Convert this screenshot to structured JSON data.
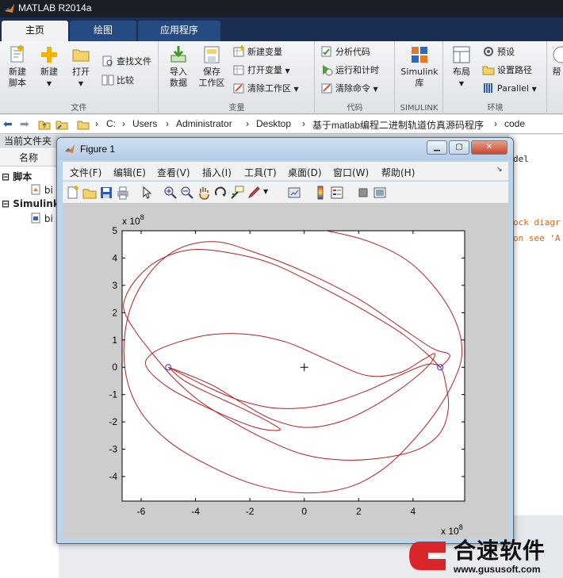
{
  "app": {
    "title": "MATLAB R2014a"
  },
  "tabs": [
    {
      "label": "主页",
      "active": true
    },
    {
      "label": "绘图",
      "active": false
    },
    {
      "label": "应用程序",
      "active": false
    }
  ],
  "ribbon": {
    "file": {
      "name": "文件",
      "new_script": "新建\n脚本",
      "new": "新建",
      "open": "打开",
      "find_files": "查找文件",
      "compare": "比较"
    },
    "variable": {
      "name": "变量",
      "import": "导入\n数据",
      "save_ws": "保存\n工作区",
      "new_var": "新建变量",
      "open_var": "打开变量",
      "clear_ws": "清除工作区"
    },
    "code": {
      "name": "代码",
      "analyze": "分析代码",
      "run_time": "运行和计时",
      "clear_cmd": "清除命令"
    },
    "simulink": {
      "name": "SIMULINK",
      "lib": "Simulink\n库"
    },
    "env": {
      "name": "环境",
      "layout": "布局",
      "prefs": "预设",
      "set_path": "设置路径",
      "parallel": "Parallel",
      "help": "帮"
    }
  },
  "address": {
    "crumbs": [
      "C:",
      "Users",
      "Administrator",
      "Desktop",
      "基于matlab编程二进制轨道仿真源码程序",
      "code"
    ]
  },
  "left": {
    "header": "当前文件夹",
    "col_name": "名称",
    "group1": "脚本",
    "item1": "bi",
    "group2": "Simulink",
    "item2": "bi"
  },
  "right": {
    "lines": [
      "del",
      "ock diagr",
      "on see ‘A"
    ]
  },
  "figure": {
    "title": "Figure 1",
    "menu": [
      "文件(F)",
      "编辑(E)",
      "查看(V)",
      "插入(I)",
      "工具(T)",
      "桌面(D)",
      "窗口(W)",
      "帮助(H)"
    ]
  },
  "chart_data": {
    "type": "line",
    "title": "",
    "xlabel": "",
    "ylabel": "",
    "x_exponent_label": "x 10",
    "y_exponent_label": "x 10",
    "exponent": "8",
    "xlim": [
      -6.7,
      5.9
    ],
    "ylim": [
      -4.9,
      5.0
    ],
    "xticks": [
      -6,
      -4,
      -2,
      0,
      2,
      4
    ],
    "yticks": [
      -4,
      -3,
      -2,
      -1,
      0,
      1,
      2,
      3,
      4,
      5
    ],
    "grid": false,
    "line_color": "#b22222",
    "marker_color": "#3333cc",
    "series": [
      {
        "x": [
          -5.0,
          -4.4,
          -3.4,
          -2.3,
          -1.3,
          -0.9,
          -1.8,
          -3.3,
          -4.9,
          -5.8,
          -5.6,
          -4.7,
          -3.4,
          -2.0,
          -0.6,
          0.8,
          2.3,
          3.5,
          4.4,
          4.8,
          4.6,
          3.8,
          2.6,
          1.3,
          0.0,
          -1.2,
          -2.3,
          -3.3,
          -4.2,
          -5.0
        ],
        "y": [
          0.0,
          -0.5,
          -1.0,
          -1.5,
          -2.0,
          -2.3,
          -2.2,
          -1.6,
          -0.8,
          0.0,
          0.5,
          0.9,
          1.2,
          1.2,
          0.9,
          0.3,
          -0.3,
          -0.2,
          0.3,
          0.5,
          0.1,
          -0.6,
          -1.4,
          -2.0,
          -2.2,
          -1.9,
          -1.3,
          -0.7,
          -0.3,
          0.0
        ]
      },
      {
        "x": [
          -5.0,
          -4.6,
          -3.6,
          -2.4,
          -1.0,
          0.6,
          2.2,
          3.5,
          4.5,
          5.0,
          5.2,
          5.3,
          5.0,
          4.2,
          3.0,
          1.5,
          0.0,
          -1.5,
          -2.8,
          -3.9,
          -4.8,
          -5.5,
          -6.2,
          -6.6,
          -6.6,
          -6.2,
          -5.4,
          -4.2,
          -2.8,
          -1.2,
          0.5,
          2.0,
          3.5,
          4.5,
          5.0
        ],
        "y": [
          0.0,
          -0.2,
          -0.7,
          -1.2,
          -1.5,
          -1.4,
          -0.9,
          -0.3,
          0.1,
          0.0,
          -0.6,
          -1.5,
          -2.4,
          -3.0,
          -3.3,
          -3.4,
          -3.2,
          -2.6,
          -1.9,
          -1.2,
          -0.4,
          0.4,
          1.3,
          2.0,
          2.5,
          3.2,
          3.9,
          4.3,
          4.2,
          3.8,
          3.0,
          2.2,
          1.3,
          0.5,
          0.0
        ]
      },
      {
        "x": [
          5.0,
          5.3,
          5.3,
          4.7,
          3.5,
          2.0,
          0.0,
          -1.8,
          -3.3,
          -4.7,
          -5.8,
          -6.5,
          -6.6,
          -6.1,
          -5.0,
          -3.5,
          -1.8,
          0.0,
          1.6,
          2.8,
          3.8,
          4.8,
          5.5,
          5.8,
          5.6,
          4.9,
          3.8,
          2.4,
          0.8,
          -0.3
        ],
        "y": [
          0.0,
          0.3,
          0.5,
          0.7,
          1.5,
          2.5,
          3.5,
          4.2,
          4.6,
          4.3,
          3.3,
          1.8,
          0.0,
          -1.5,
          -2.7,
          -3.6,
          -4.3,
          -4.6,
          -4.4,
          -3.8,
          -2.9,
          -1.7,
          -0.5,
          0.5,
          1.6,
          2.8,
          3.9,
          4.6,
          5.0,
          5.1
        ]
      }
    ],
    "markers": [
      {
        "x": -5.0,
        "y": 0.0,
        "shape": "circle"
      },
      {
        "x": 5.0,
        "y": 0.0,
        "shape": "circle"
      },
      {
        "x": 0.0,
        "y": 0.0,
        "shape": "plus"
      }
    ]
  },
  "watermark": {
    "brand": "合速软件",
    "url": "www.gususoft.com"
  }
}
